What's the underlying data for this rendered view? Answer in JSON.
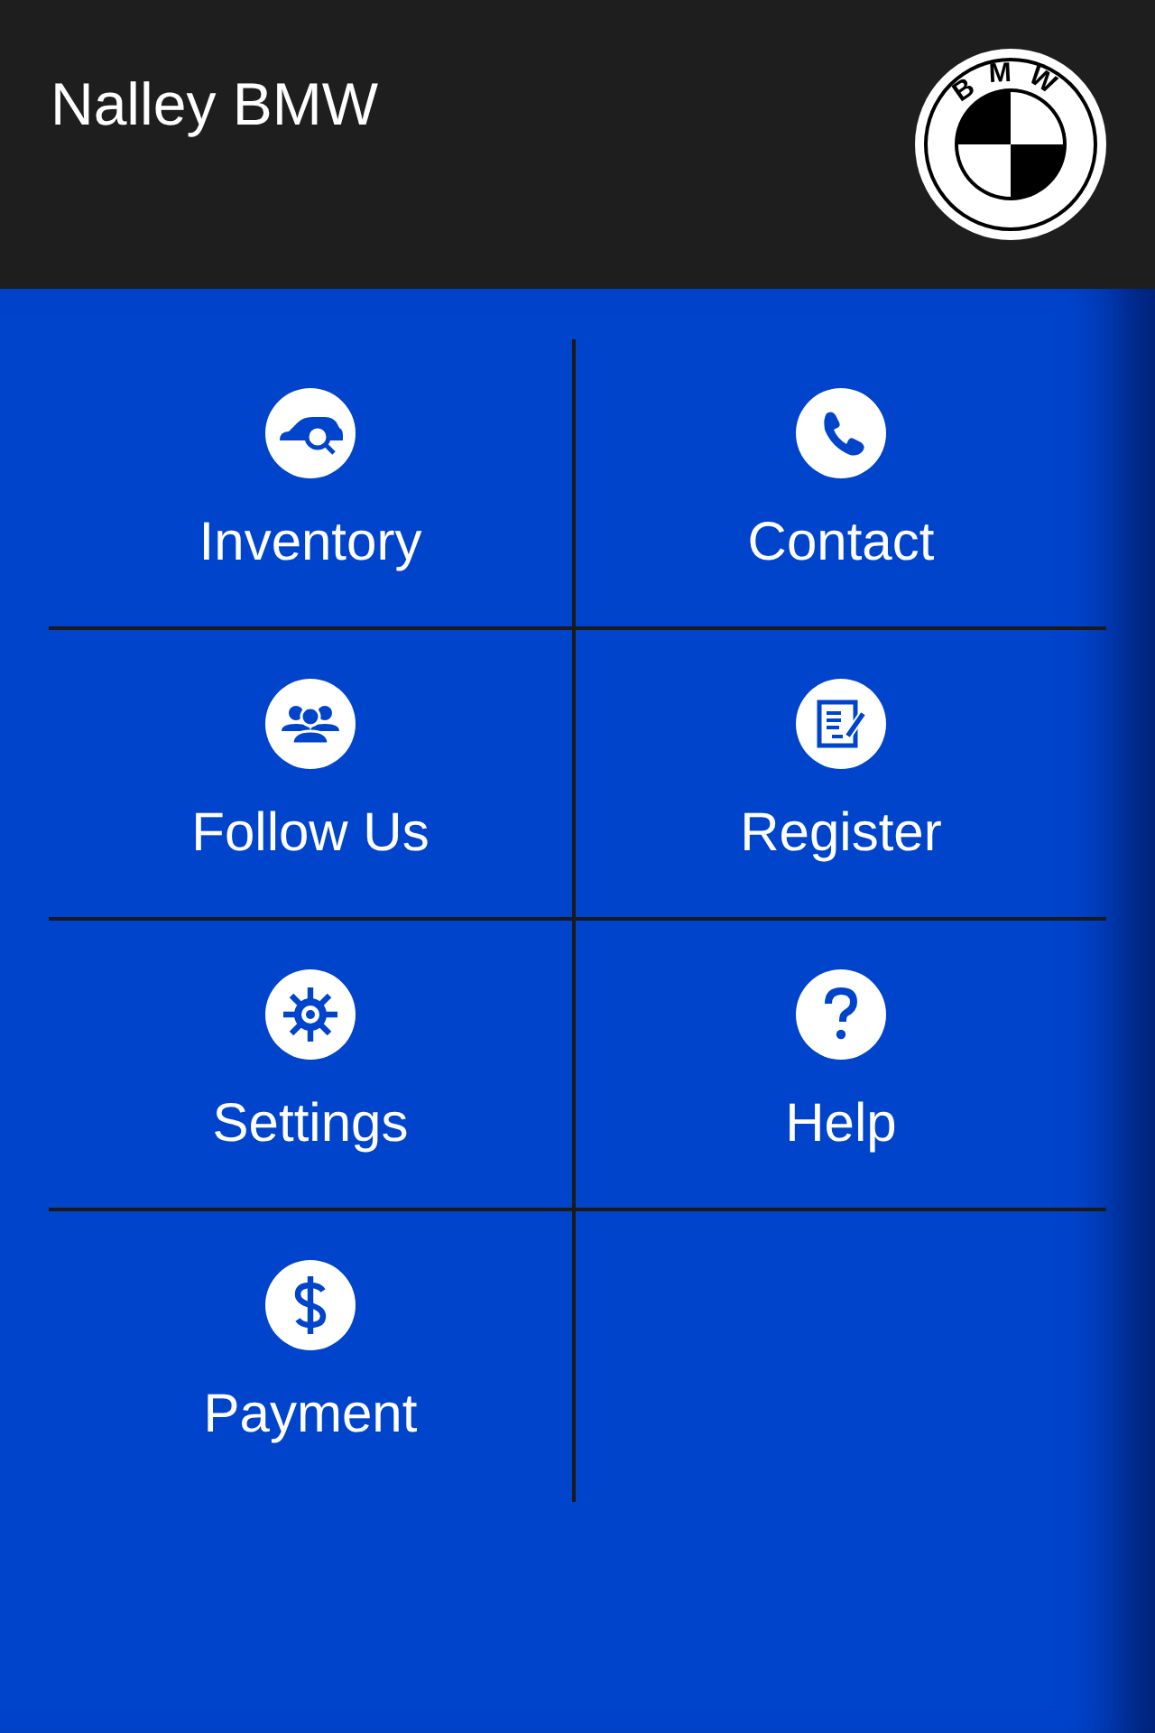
{
  "header": {
    "title": "Nalley BMW",
    "logo_text": "BMW"
  },
  "menu": [
    {
      "label": "Inventory",
      "kind": "car-search"
    },
    {
      "label": "Contact",
      "kind": "phone"
    },
    {
      "label": "Follow Us",
      "kind": "people"
    },
    {
      "label": "Register",
      "kind": "form"
    },
    {
      "label": "Settings",
      "kind": "gear"
    },
    {
      "label": "Help",
      "kind": "question"
    },
    {
      "label": "Payment",
      "kind": "dollar"
    }
  ]
}
